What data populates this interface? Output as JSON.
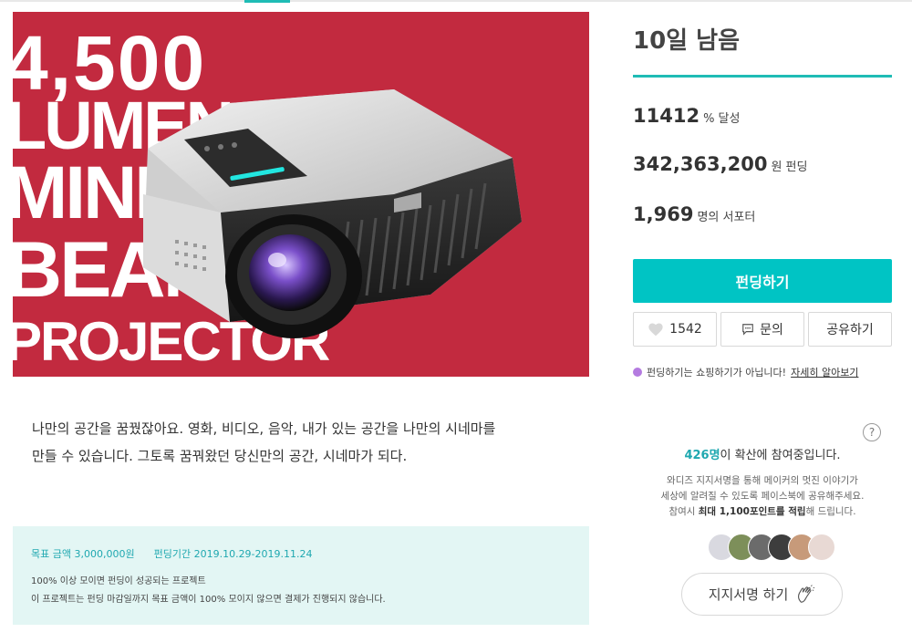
{
  "hero": {
    "lines": [
      "4,500",
      "LUMEN",
      "MINI",
      "BEAM",
      "PROJECTOR"
    ],
    "background_color": "#c22a3f"
  },
  "campaign": {
    "days_left": "10일 남음",
    "achieved_value": "11412",
    "achieved_unit": "% 달성",
    "funded_value": "342,363,200",
    "funded_unit": "원 펀딩",
    "supporters_value": "1,969",
    "supporters_unit": "명의 서포터",
    "accent_color": "#1fbcb5"
  },
  "actions": {
    "fund_label": "펀딩하기",
    "like_count": "1542",
    "ask_label": "문의",
    "share_label": "공유하기",
    "like_icon": "heart-icon",
    "ask_icon": "chat-icon"
  },
  "notice": {
    "text": "펀딩하기는 쇼핑하기가 아닙니다!",
    "link": "자세히 알아보기"
  },
  "spread": {
    "help": "?",
    "count": "426명",
    "suffix": "이 확산에 참여중입니다.",
    "desc_line1": "와디즈 지지서명을 통해 메이커의 멋진 이야기가",
    "desc_line2": "세상에 알려질 수 있도록 페이스북에 공유해주세요.",
    "desc_line3_prefix": "참여시 ",
    "desc_line3_bold": "최대 1,100포인트를 적립",
    "desc_line3_suffix": "해 드립니다.",
    "sign_label": "지지서명 하기",
    "sign_icon": "clap-icon"
  },
  "description": {
    "line1": "나만의 공간을 꿈꿨잖아요. 영화, 비디오, 음악, 내가 있는 공간을 나만의 시네마를",
    "line2": "만들 수 있습니다. 그토록 꿈꿔왔던 당신만의 공간, 시네마가 되다."
  },
  "info": {
    "goal_label": "목표 금액",
    "goal_value": "3,000,000원",
    "period_label": "펀딩기간",
    "period_value": "2019.10.29-2019.11.24",
    "line1": "100% 이상 모이면 펀딩이 성공되는 프로젝트",
    "line2": "이 프로젝트는 펀딩 마감일까지 목표 금액이 100% 모이지 않으면 결제가 진행되지 않습니다."
  }
}
